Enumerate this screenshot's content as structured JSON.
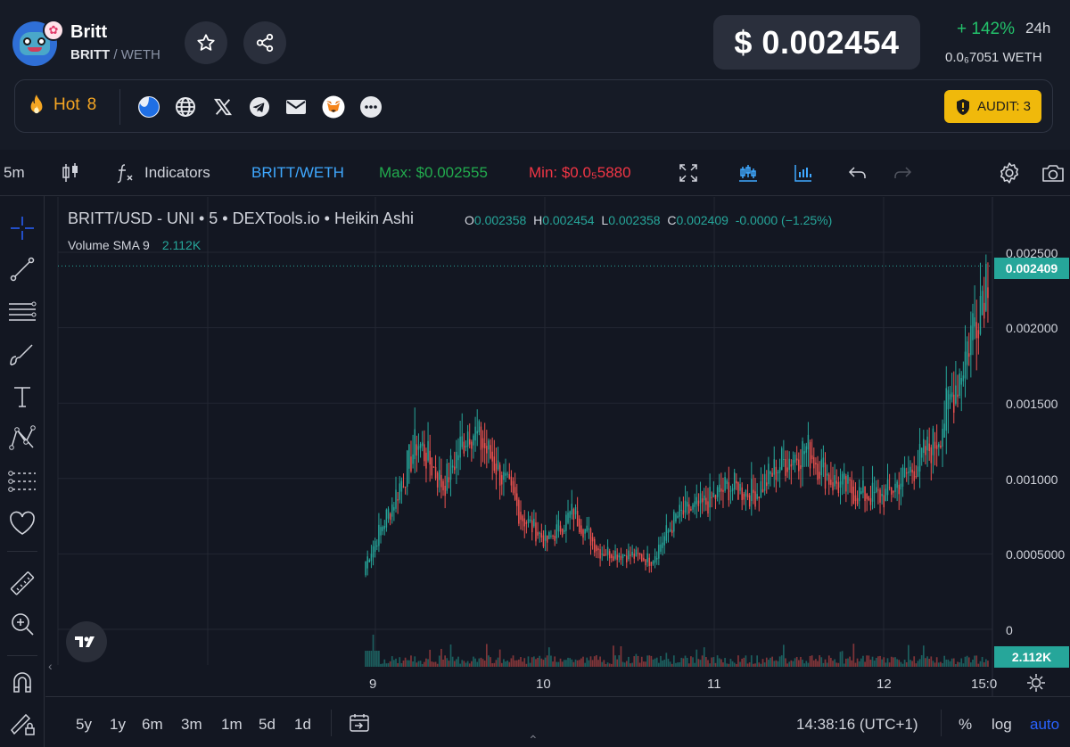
{
  "token": {
    "name": "Britt",
    "symbol": "BRITT",
    "separator": "/",
    "quote": "WETH"
  },
  "price": {
    "usd": "$ 0.002454",
    "change": "+ 142%",
    "period": "24h",
    "weth": "0.0₆7051  WETH"
  },
  "info": {
    "hot_label": "Hot",
    "hot_rank": "8",
    "audit_label": "AUDIT: 3",
    "socials": [
      "dextools-icon",
      "globe-icon",
      "x-twitter-icon",
      "telegram-icon",
      "mail-icon",
      "metamask-icon",
      "more-icon"
    ]
  },
  "toolbar": {
    "interval": "5m",
    "indicators": "Indicators",
    "pair": "BRITT/WETH",
    "max": "Max: $0.002555",
    "min": "Min: $0.0₅5880"
  },
  "legend": {
    "title": "BRITT/USD - UNI • 5 • DEXTools.io • Heikin Ashi",
    "o_key": "O",
    "o": "0.002358",
    "h_key": "H",
    "h": "0.002454",
    "l_key": "L",
    "l": "0.002358",
    "c_key": "C",
    "c": "0.002409",
    "chg": "-0.0000 (−1.25%)",
    "volume_label": "Volume SMA 9",
    "volume_value": "2.112K"
  },
  "axis": {
    "y_ticks": [
      "0.002500",
      "0.002000",
      "0.001500",
      "0.001000",
      "0.0005000",
      "0"
    ],
    "x_ticks": [
      "9",
      "10",
      "11",
      "12",
      "15:0"
    ],
    "last_price_tag": "0.002409",
    "volume_tag": "2.112K"
  },
  "bottom": {
    "ranges": [
      "5y",
      "1y",
      "6m",
      "3m",
      "1m",
      "5d",
      "1d"
    ],
    "time": "14:38:16 (UTC+1)",
    "percent": "%",
    "log": "log",
    "auto": "auto"
  },
  "colors": {
    "up": "#26a69a",
    "down": "#ef5350",
    "accent": "#2962ff",
    "pair": "#3fa8ff",
    "max": "#22ab4e",
    "min": "#f23645",
    "audit": "#f0b90b"
  },
  "chart_data": {
    "type": "candlestick",
    "style": "Heikin Ashi",
    "interval": "5",
    "x": [
      "9",
      "9",
      "9",
      "9",
      "9",
      "9",
      "10",
      "10",
      "10",
      "10",
      "10",
      "10",
      "11",
      "11",
      "11",
      "11",
      "11",
      "11",
      "12",
      "12",
      "12",
      "12",
      "12",
      "12",
      "15:0"
    ],
    "close": [
      0.00045,
      0.00082,
      0.00125,
      0.00095,
      0.00135,
      0.0011,
      0.00075,
      0.00058,
      0.00078,
      0.00052,
      0.0005,
      0.00046,
      0.00075,
      0.00082,
      0.00095,
      0.0009,
      0.0011,
      0.0012,
      0.00098,
      0.0009,
      0.00088,
      0.00105,
      0.00125,
      0.00175,
      0.002409
    ],
    "ylim": [
      0,
      0.0026
    ],
    "y_ticks": [
      0,
      0.0005,
      0.001,
      0.0015,
      0.002,
      0.0025
    ]
  }
}
